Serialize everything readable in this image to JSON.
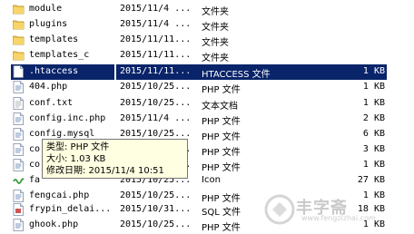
{
  "files": [
    {
      "name": "module",
      "date": "2015/11/4 ...",
      "type": "文件夹",
      "size": "",
      "icon": "folder-icon"
    },
    {
      "name": "plugins",
      "date": "2015/11/4 ...",
      "type": "文件夹",
      "size": "",
      "icon": "folder-icon"
    },
    {
      "name": "templates",
      "date": "2015/11/11...",
      "type": "文件夹",
      "size": "",
      "icon": "folder-icon"
    },
    {
      "name": "templates_c",
      "date": "2015/11/11...",
      "type": "文件夹",
      "size": "",
      "icon": "folder-icon"
    },
    {
      "name": ".htaccess",
      "date": "2015/11/11...",
      "type": "HTACCESS 文件",
      "size": "1 KB",
      "icon": "file-icon",
      "selected": true
    },
    {
      "name": "404.php",
      "date": "2015/10/25...",
      "type": "PHP 文件",
      "size": "1 KB",
      "icon": "php-file-icon"
    },
    {
      "name": "conf.txt",
      "date": "2015/10/25...",
      "type": "文本文档",
      "size": "1 KB",
      "icon": "text-file-icon"
    },
    {
      "name": "config.inc.php",
      "date": "2015/11/4 ...",
      "type": "PHP 文件",
      "size": "2 KB",
      "icon": "php-file-icon"
    },
    {
      "name": "config.mysql",
      "date": "2015/10/25...",
      "type": "PHP 文件",
      "size": "6 KB",
      "icon": "php-file-icon"
    },
    {
      "name": "co",
      "date": "2015/10/25...",
      "type": "PHP 文件",
      "size": "3 KB",
      "icon": "php-file-icon"
    },
    {
      "name": "co",
      "date": "2015/10/25...",
      "type": "PHP 文件",
      "size": "1 KB",
      "icon": "php-file-icon"
    },
    {
      "name": "fa",
      "date": "2015/10/25...",
      "type": "Icon",
      "size": "27 KB",
      "icon": "favicon-icon"
    },
    {
      "name": "fengcai.php",
      "date": "2015/10/25...",
      "type": "PHP 文件",
      "size": "1 KB",
      "icon": "php-file-icon"
    },
    {
      "name": "frypin_delai...",
      "date": "2015/10/31...",
      "type": "SQL 文件",
      "size": "18 KB",
      "icon": "sql-file-icon"
    },
    {
      "name": "ghook.php",
      "date": "2015/10/25...",
      "type": "PHP 文件",
      "size": "1 KB",
      "icon": "php-file-icon"
    }
  ],
  "tooltip": {
    "type_line": "类型: PHP 文件",
    "size_line": "大小: 1.03 KB",
    "date_line": "修改日期: 2015/11/4 10:51"
  },
  "watermark": {
    "text": "丰字斋",
    "url": "www.fengzizhai.com"
  }
}
